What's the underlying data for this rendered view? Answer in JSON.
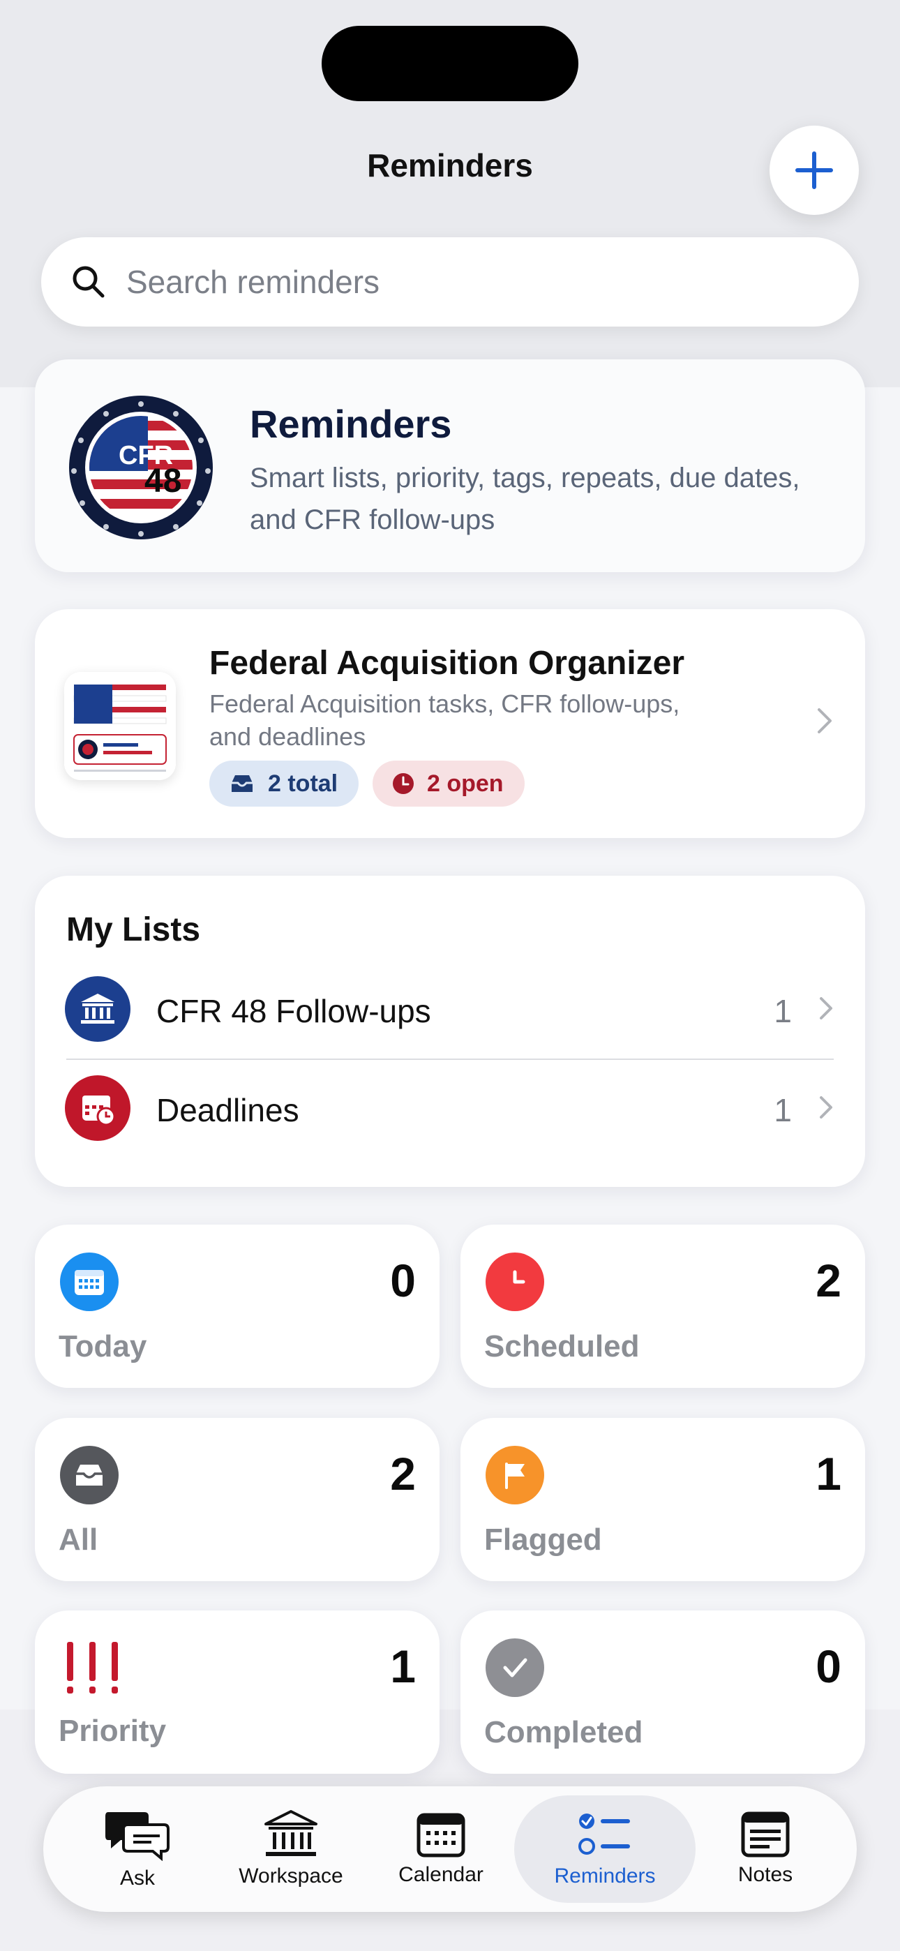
{
  "header": {
    "title": "Reminders"
  },
  "search": {
    "placeholder": "Search reminders"
  },
  "hero": {
    "title": "Reminders",
    "subtitle": "Smart lists, priority, tags, repeats, due dates, and CFR follow-ups"
  },
  "organizer": {
    "title": "Federal Acquisition Organizer",
    "subtitle": "Federal Acquisition tasks, CFR follow-ups, and deadlines",
    "total_label": "2 total",
    "open_label": "2 open"
  },
  "my_lists": {
    "heading": "My Lists",
    "items": [
      {
        "label": "CFR 48 Follow-ups",
        "count": "1",
        "color": "#1c3f8f",
        "icon": "building-columns-icon"
      },
      {
        "label": "Deadlines",
        "count": "1",
        "color": "#c0172a",
        "icon": "calendar-clock-icon"
      }
    ]
  },
  "smart_lists": [
    {
      "label": "Today",
      "count": "0",
      "color": "#1a8ff0",
      "icon": "calendar-icon"
    },
    {
      "label": "Scheduled",
      "count": "2",
      "color": "#f23a3f",
      "icon": "clock-icon"
    },
    {
      "label": "All",
      "count": "2",
      "color": "#55575c",
      "icon": "tray-icon"
    },
    {
      "label": "Flagged",
      "count": "1",
      "color": "#f7932a",
      "icon": "flag-icon"
    },
    {
      "label": "Priority",
      "count": "1",
      "color": "#c4192d",
      "icon": "exclamation-icon"
    },
    {
      "label": "Completed",
      "count": "0",
      "color": "#8e8f94",
      "icon": "checkmark-icon"
    }
  ],
  "tabbar": {
    "items": [
      {
        "label": "Ask",
        "icon": "chat-bubbles-icon"
      },
      {
        "label": "Workspace",
        "icon": "building-columns-icon"
      },
      {
        "label": "Calendar",
        "icon": "calendar-icon"
      },
      {
        "label": "Reminders",
        "icon": "checklist-icon",
        "selected": true
      },
      {
        "label": "Notes",
        "icon": "notes-icon"
      }
    ],
    "accent": "#1c5fd0"
  }
}
